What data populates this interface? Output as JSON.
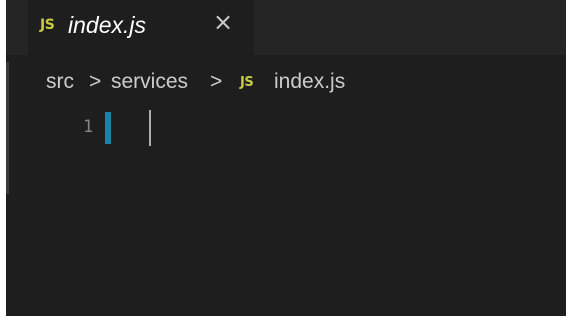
{
  "tab": {
    "icon": "JS",
    "label": "index.js",
    "close_glyph": "×"
  },
  "breadcrumb": {
    "items": [
      "src",
      "services",
      "index.js"
    ],
    "separator": ">",
    "file_icon": "JS"
  },
  "editor": {
    "line_numbers": [
      "1"
    ]
  },
  "colors": {
    "background": "#1e1e1e",
    "tabbar": "#252526",
    "js_icon": "#cbcb41",
    "modified_marker": "#1b81a8",
    "line_number": "#858585"
  },
  "icons": {
    "tab_file_icon": "javascript-file-icon",
    "tab_close": "close-icon",
    "breadcrumb_separator": "chevron-right-icon",
    "breadcrumb_file_icon": "javascript-file-icon"
  }
}
